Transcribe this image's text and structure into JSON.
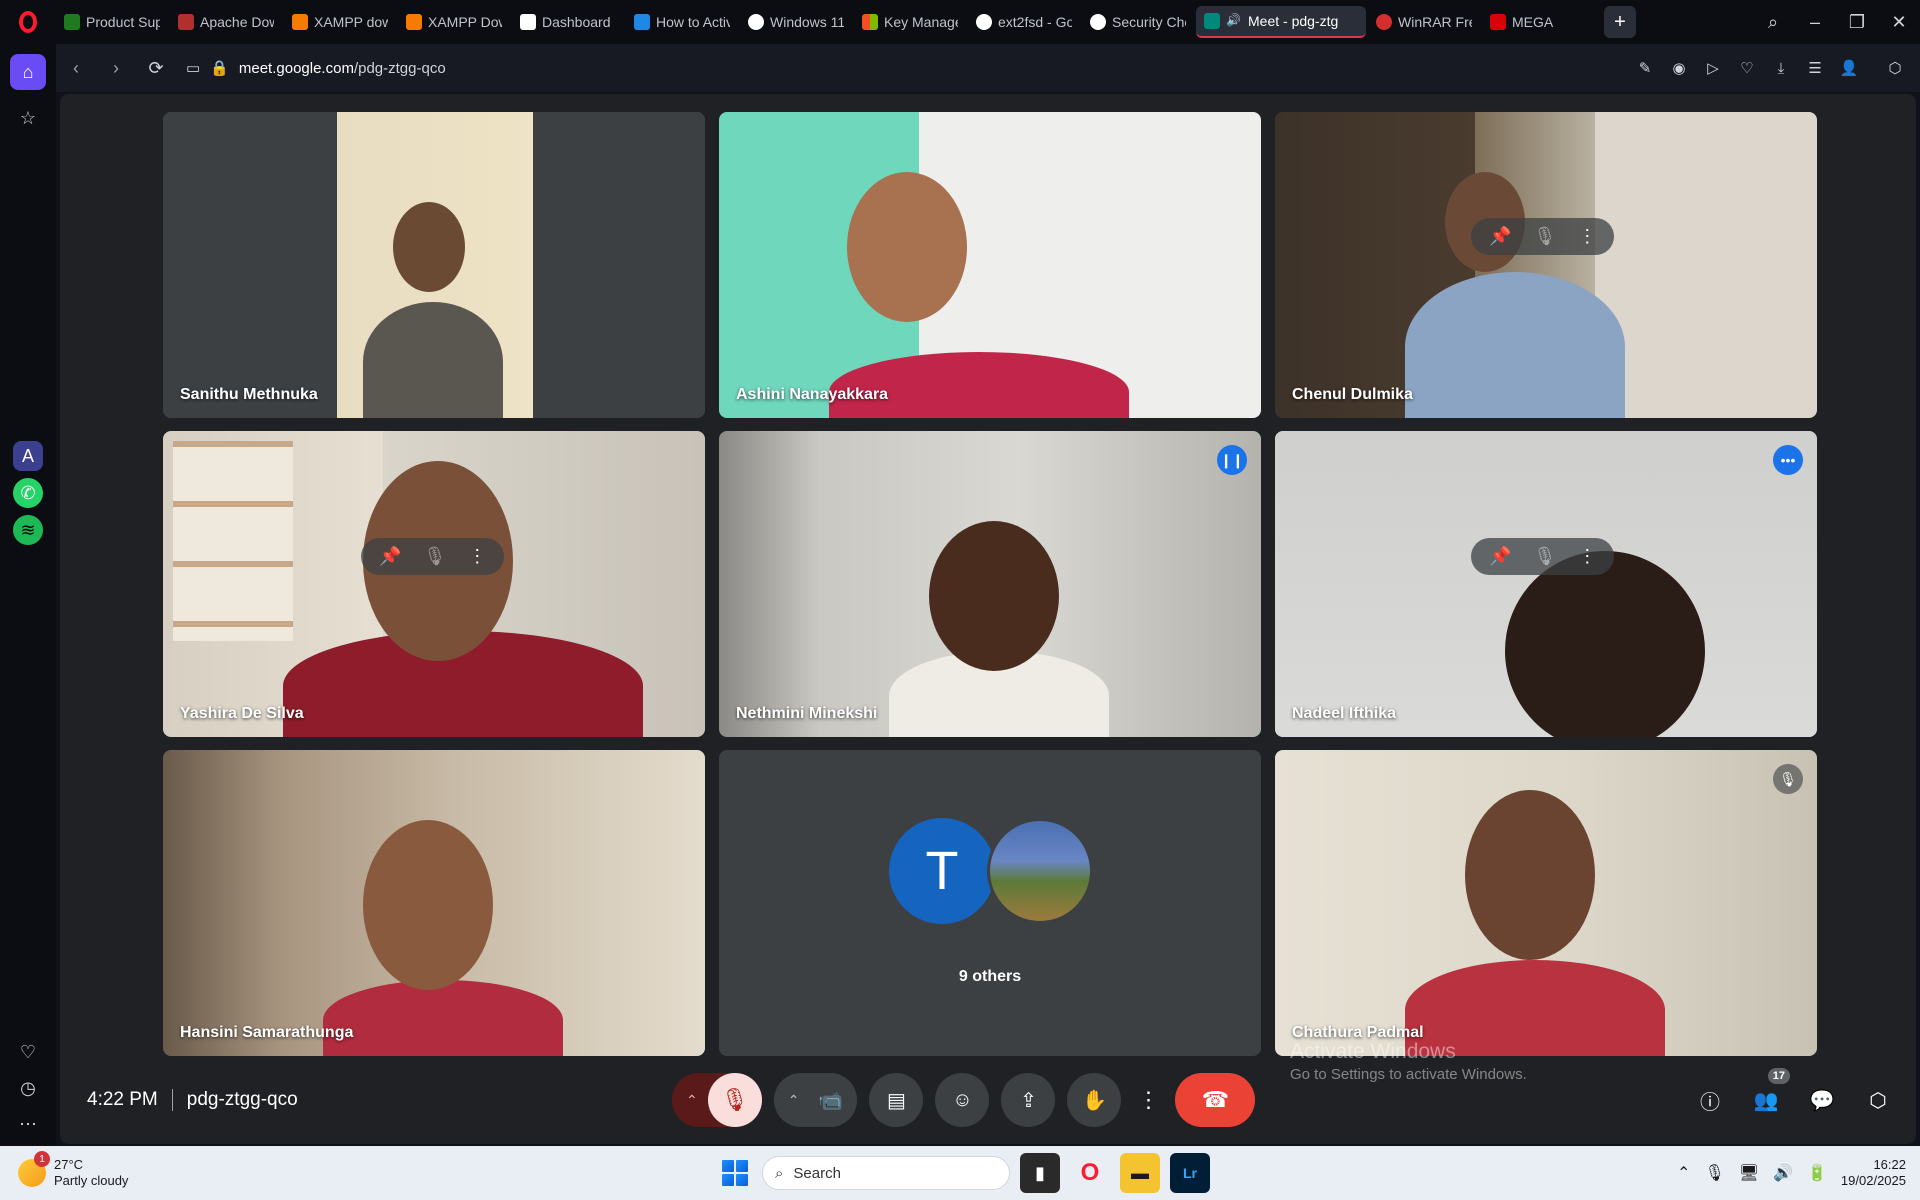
{
  "browser": {
    "tabs": [
      {
        "label": "Product Supp",
        "color": "#1f7a1f"
      },
      {
        "label": "Apache Down",
        "color": "#b03030"
      },
      {
        "label": "XAMPP down",
        "color": "#f57c00"
      },
      {
        "label": "XAMPP Down",
        "color": "#f57c00"
      },
      {
        "label": "Dashboard",
        "color": "#ffffff"
      },
      {
        "label": "How to Activa",
        "color": "#1e88e5"
      },
      {
        "label": "Windows 11 P",
        "color": "#ffffff"
      },
      {
        "label": "Key Managem",
        "color": "#f25022"
      },
      {
        "label": "ext2fsd - Goo",
        "color": "#ffffff"
      },
      {
        "label": "Security Chec",
        "color": "#ffffff"
      },
      {
        "label": "Meet - pdg-ztg",
        "color": "#00897b",
        "active": true
      },
      {
        "label": "WinRAR Free",
        "color": "#d32f2f"
      },
      {
        "label": "MEGA",
        "color": "#d90007"
      }
    ],
    "url_host": "meet.google.com",
    "url_path": "/pdg-ztgg-qco"
  },
  "participants": [
    {
      "name": "Sanithu Methnuka"
    },
    {
      "name": "Ashini Nanayakkara"
    },
    {
      "name": "Chenul Dulmika"
    },
    {
      "name": "Yashira De Silva"
    },
    {
      "name": "Nethmini Minekshi"
    },
    {
      "name": "Nadeel Ifthika"
    },
    {
      "name": "Hansini Samarathunga"
    },
    {
      "name": "Chathura Padmal"
    }
  ],
  "others": {
    "avatar_letter": "T",
    "label": "9 others"
  },
  "meeting": {
    "time": "4:22 PM",
    "code": "pdg-ztgg-qco",
    "people_count": "17"
  },
  "watermark": {
    "line1": "Activate Windows",
    "line2": "Go to Settings to activate Windows."
  },
  "taskbar": {
    "weather_badge": "1",
    "temperature": "27°C",
    "condition": "Partly cloudy",
    "search_label": "Search",
    "clock_time": "16:22",
    "clock_date": "19/02/2025"
  },
  "colors": {
    "accent": "#8ab4f8",
    "end_call": "#ea4335",
    "mic_off_bg": "#f9dedc",
    "opera": "#ff1b2d"
  }
}
